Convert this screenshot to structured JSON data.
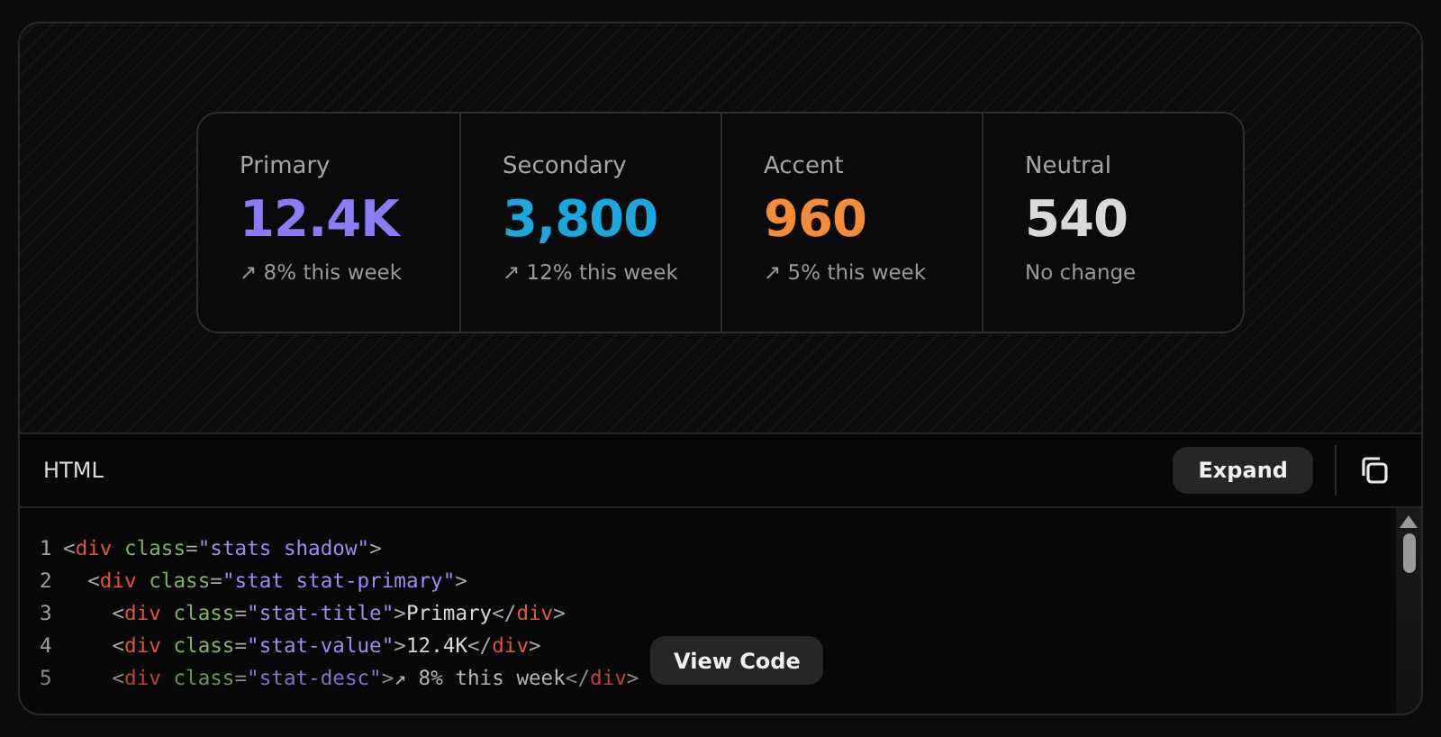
{
  "stats": [
    {
      "title": "Primary",
      "value": "12.4K",
      "desc": "↗ 8% this week",
      "color": "#8b7cf6"
    },
    {
      "title": "Secondary",
      "value": "3,800",
      "desc": "↗ 12% this week",
      "color": "#1ba6dc"
    },
    {
      "title": "Accent",
      "value": "960",
      "desc": "↗ 5% this week",
      "color": "#f28c3b"
    },
    {
      "title": "Neutral",
      "value": "540",
      "desc": "No change",
      "color": "#d9d9d9"
    }
  ],
  "code_panel": {
    "language": "HTML",
    "expand_button": "Expand",
    "view_code_button": "View Code",
    "lines": [
      {
        "number": "1",
        "tokens": [
          {
            "kind": "punct",
            "text": "<"
          },
          {
            "kind": "tag",
            "text": "div"
          },
          {
            "kind": "attr",
            "text": " class"
          },
          {
            "kind": "punct",
            "text": "="
          },
          {
            "kind": "string",
            "text": "\"stats shadow\""
          },
          {
            "kind": "punct",
            "text": ">"
          }
        ]
      },
      {
        "number": "2",
        "tokens": [
          {
            "kind": "punct",
            "text": "  <"
          },
          {
            "kind": "tag",
            "text": "div"
          },
          {
            "kind": "attr",
            "text": " class"
          },
          {
            "kind": "punct",
            "text": "="
          },
          {
            "kind": "string",
            "text": "\"stat stat-primary\""
          },
          {
            "kind": "punct",
            "text": ">"
          }
        ]
      },
      {
        "number": "3",
        "tokens": [
          {
            "kind": "punct",
            "text": "    <"
          },
          {
            "kind": "tag",
            "text": "div"
          },
          {
            "kind": "attr",
            "text": " class"
          },
          {
            "kind": "punct",
            "text": "="
          },
          {
            "kind": "string",
            "text": "\"stat-title\""
          },
          {
            "kind": "punct",
            "text": ">"
          },
          {
            "kind": "text",
            "text": "Primary"
          },
          {
            "kind": "punct",
            "text": "</"
          },
          {
            "kind": "tag",
            "text": "div"
          },
          {
            "kind": "punct",
            "text": ">"
          }
        ]
      },
      {
        "number": "4",
        "tokens": [
          {
            "kind": "punct",
            "text": "    <"
          },
          {
            "kind": "tag",
            "text": "div"
          },
          {
            "kind": "attr",
            "text": " class"
          },
          {
            "kind": "punct",
            "text": "="
          },
          {
            "kind": "string",
            "text": "\"stat-value\""
          },
          {
            "kind": "punct",
            "text": ">"
          },
          {
            "kind": "text",
            "text": "12.4K"
          },
          {
            "kind": "punct",
            "text": "</"
          },
          {
            "kind": "tag",
            "text": "div"
          },
          {
            "kind": "punct",
            "text": ">"
          }
        ]
      },
      {
        "number": "5",
        "tokens": [
          {
            "kind": "punct",
            "text": "    <"
          },
          {
            "kind": "tag",
            "text": "div"
          },
          {
            "kind": "attr",
            "text": " class"
          },
          {
            "kind": "punct",
            "text": "="
          },
          {
            "kind": "string",
            "text": "\"stat-desc\""
          },
          {
            "kind": "punct",
            "text": ">"
          },
          {
            "kind": "text",
            "text": "↗ 8% this week"
          },
          {
            "kind": "punct",
            "text": "</"
          },
          {
            "kind": "tag",
            "text": "div"
          },
          {
            "kind": "punct",
            "text": ">"
          }
        ]
      }
    ]
  }
}
